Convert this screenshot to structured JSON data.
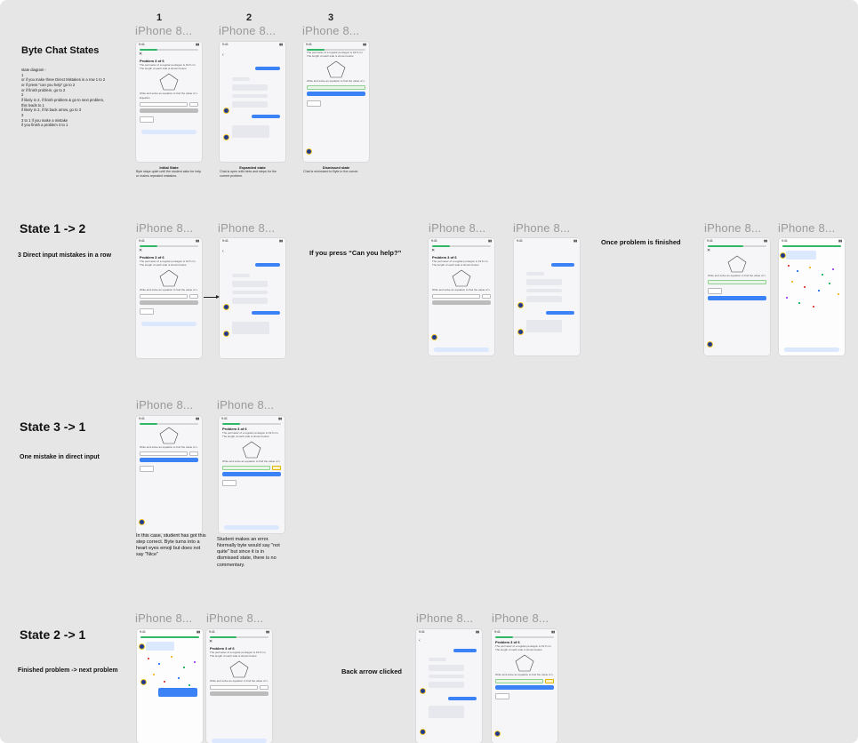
{
  "board": {
    "title": "Byte Chat States",
    "frame_label": "iPhone 8...",
    "column_numbers": [
      "1",
      "2",
      "3"
    ],
    "state_diagram_notes": "state diagram -\n1\nor if you make three Direct Mistakes in a row 1 to 2\nor if press \"can you help\" go to 2\nor if finish problem, go to 2\n2\nif likely in 2, if finish problem & go to next problem,\nthis leads to 1\nif likely in 2, if hit back arrow, go to 3\n3\n3 to 1 if you make a mistake\nif you finish a problem 3 to 1",
    "top_captions": {
      "initial": "Initial State",
      "expanded": "Expanded state",
      "dismissed": "Dismissed state"
    }
  },
  "sections": {
    "s12_title": "State 1 -> 2",
    "s12_sub": "3 Direct input mistakes in a row",
    "s12_mid_help": "If you press “Can you help?”",
    "s12_mid_finished": "Once problem is finished",
    "s31_title": "State  3 -> 1",
    "s31_sub": "One mistake in direct input",
    "s31_caption_left": "In this case, student has got this\nstep correct. Byte turns into a\nheart eyes emoji but does not\nsay \"Nice\"",
    "s31_caption_right": "Student makes an error.\nNormally byte would say \"not\nquite\" but since it is in\ndismissed state, there is no\ncommentary.",
    "s21_title": "State 2 -> 1",
    "s21_sub": "Finished problem -> next problem",
    "s21_mid_back": "Back arrow clicked"
  },
  "phone": {
    "time": "9:41",
    "problem_title": "Problem 3 of 6",
    "problem_text": "The perimeter of a regular pentagon is 19.5 cm. The length of each side is shown below.",
    "question": "Write and solve an equation to find the value of x.",
    "equation_label": "Equation",
    "check": "Check",
    "help": "Can you help me?",
    "chat_all_right": "All right.",
    "chat_lets_check": "Let's check out the first problem in your assignment.",
    "chat_try": "Try to work it out first.",
    "chat_here": "Here we go!"
  },
  "colors": {
    "canvas": "#e6e6e6",
    "accent": "#3b82f6",
    "success": "#2fb866",
    "byte_body": "#1e3a8a",
    "byte_ring": "#f2c230"
  }
}
